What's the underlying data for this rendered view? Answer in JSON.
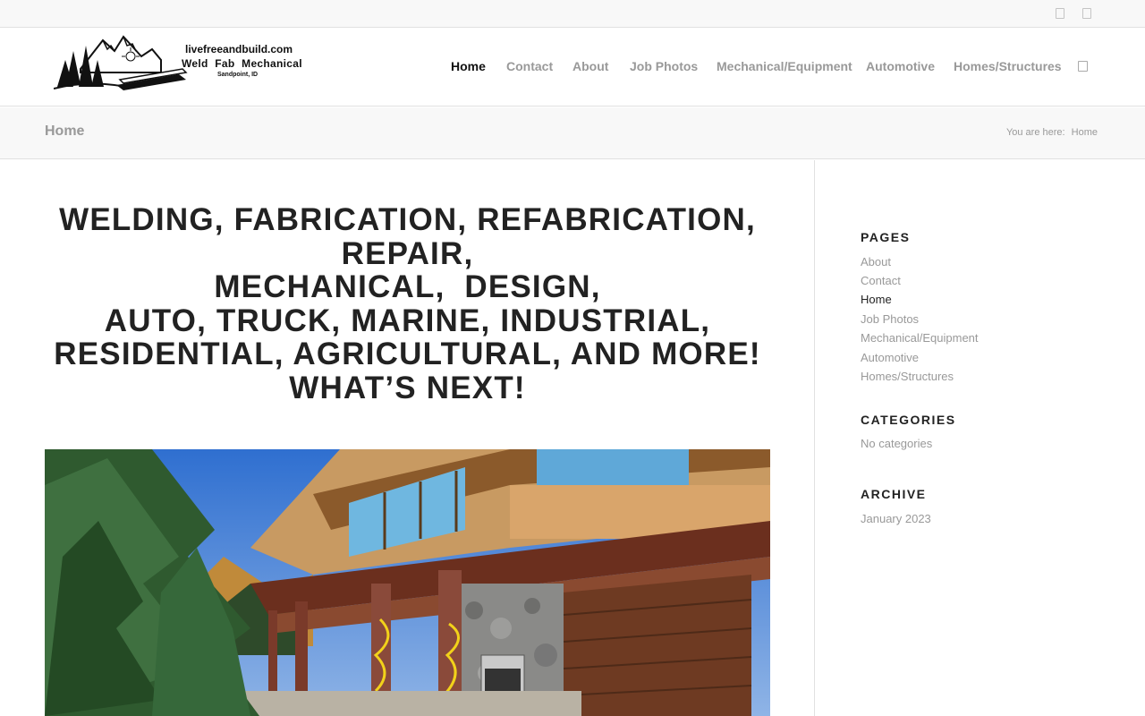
{
  "header": {
    "logo": {
      "line1": "livefreeandbuild.com",
      "line2": "Weld Fab Mechanical",
      "line3": "Sandpoint, ID"
    },
    "nav": [
      {
        "label": "Home",
        "active": true
      },
      {
        "label": "Contact",
        "active": false
      },
      {
        "label": "About",
        "active": false
      },
      {
        "label": "Job Photos",
        "active": false
      },
      {
        "label": "Mechanical/Equipment",
        "active": false
      },
      {
        "label": "Automotive",
        "active": false
      },
      {
        "label": "Homes/Structures",
        "active": false
      }
    ],
    "search_icon": "search-icon"
  },
  "topbar": {
    "icons": [
      "social-icon",
      "social-icon"
    ]
  },
  "titlebar": {
    "title": "Home",
    "breadcrumb_prefix": "You are here:",
    "breadcrumb_current": "Home"
  },
  "main": {
    "headline_lines": [
      "WELDING, FABRICATION, REFABRICATION,",
      "REPAIR,",
      "MECHANICAL,  DESIGN,",
      "AUTO, TRUCK, MARINE, INDUSTRIAL,",
      "RESIDENTIAL, AGRICULTURAL, AND MORE!",
      "WHAT’S NEXT!"
    ]
  },
  "sidebar": {
    "pages_title": "PAGES",
    "pages": [
      {
        "label": "About",
        "current": false
      },
      {
        "label": "Contact",
        "current": false
      },
      {
        "label": "Home",
        "current": true
      },
      {
        "label": "Job Photos",
        "current": false
      },
      {
        "label": "Mechanical/Equipment",
        "current": false
      },
      {
        "label": "Automotive",
        "current": false
      },
      {
        "label": "Homes/Structures",
        "current": false
      }
    ],
    "categories_title": "CATEGORIES",
    "categories_empty": "No categories",
    "archive_title": "ARCHIVE",
    "archive_items": [
      "January 2023"
    ]
  },
  "colors": {
    "nav_active": "#111111",
    "nav_inactive": "#999999",
    "heading": "#222222",
    "bar_background": "#f8f8f8",
    "border": "#e1e1e1"
  }
}
